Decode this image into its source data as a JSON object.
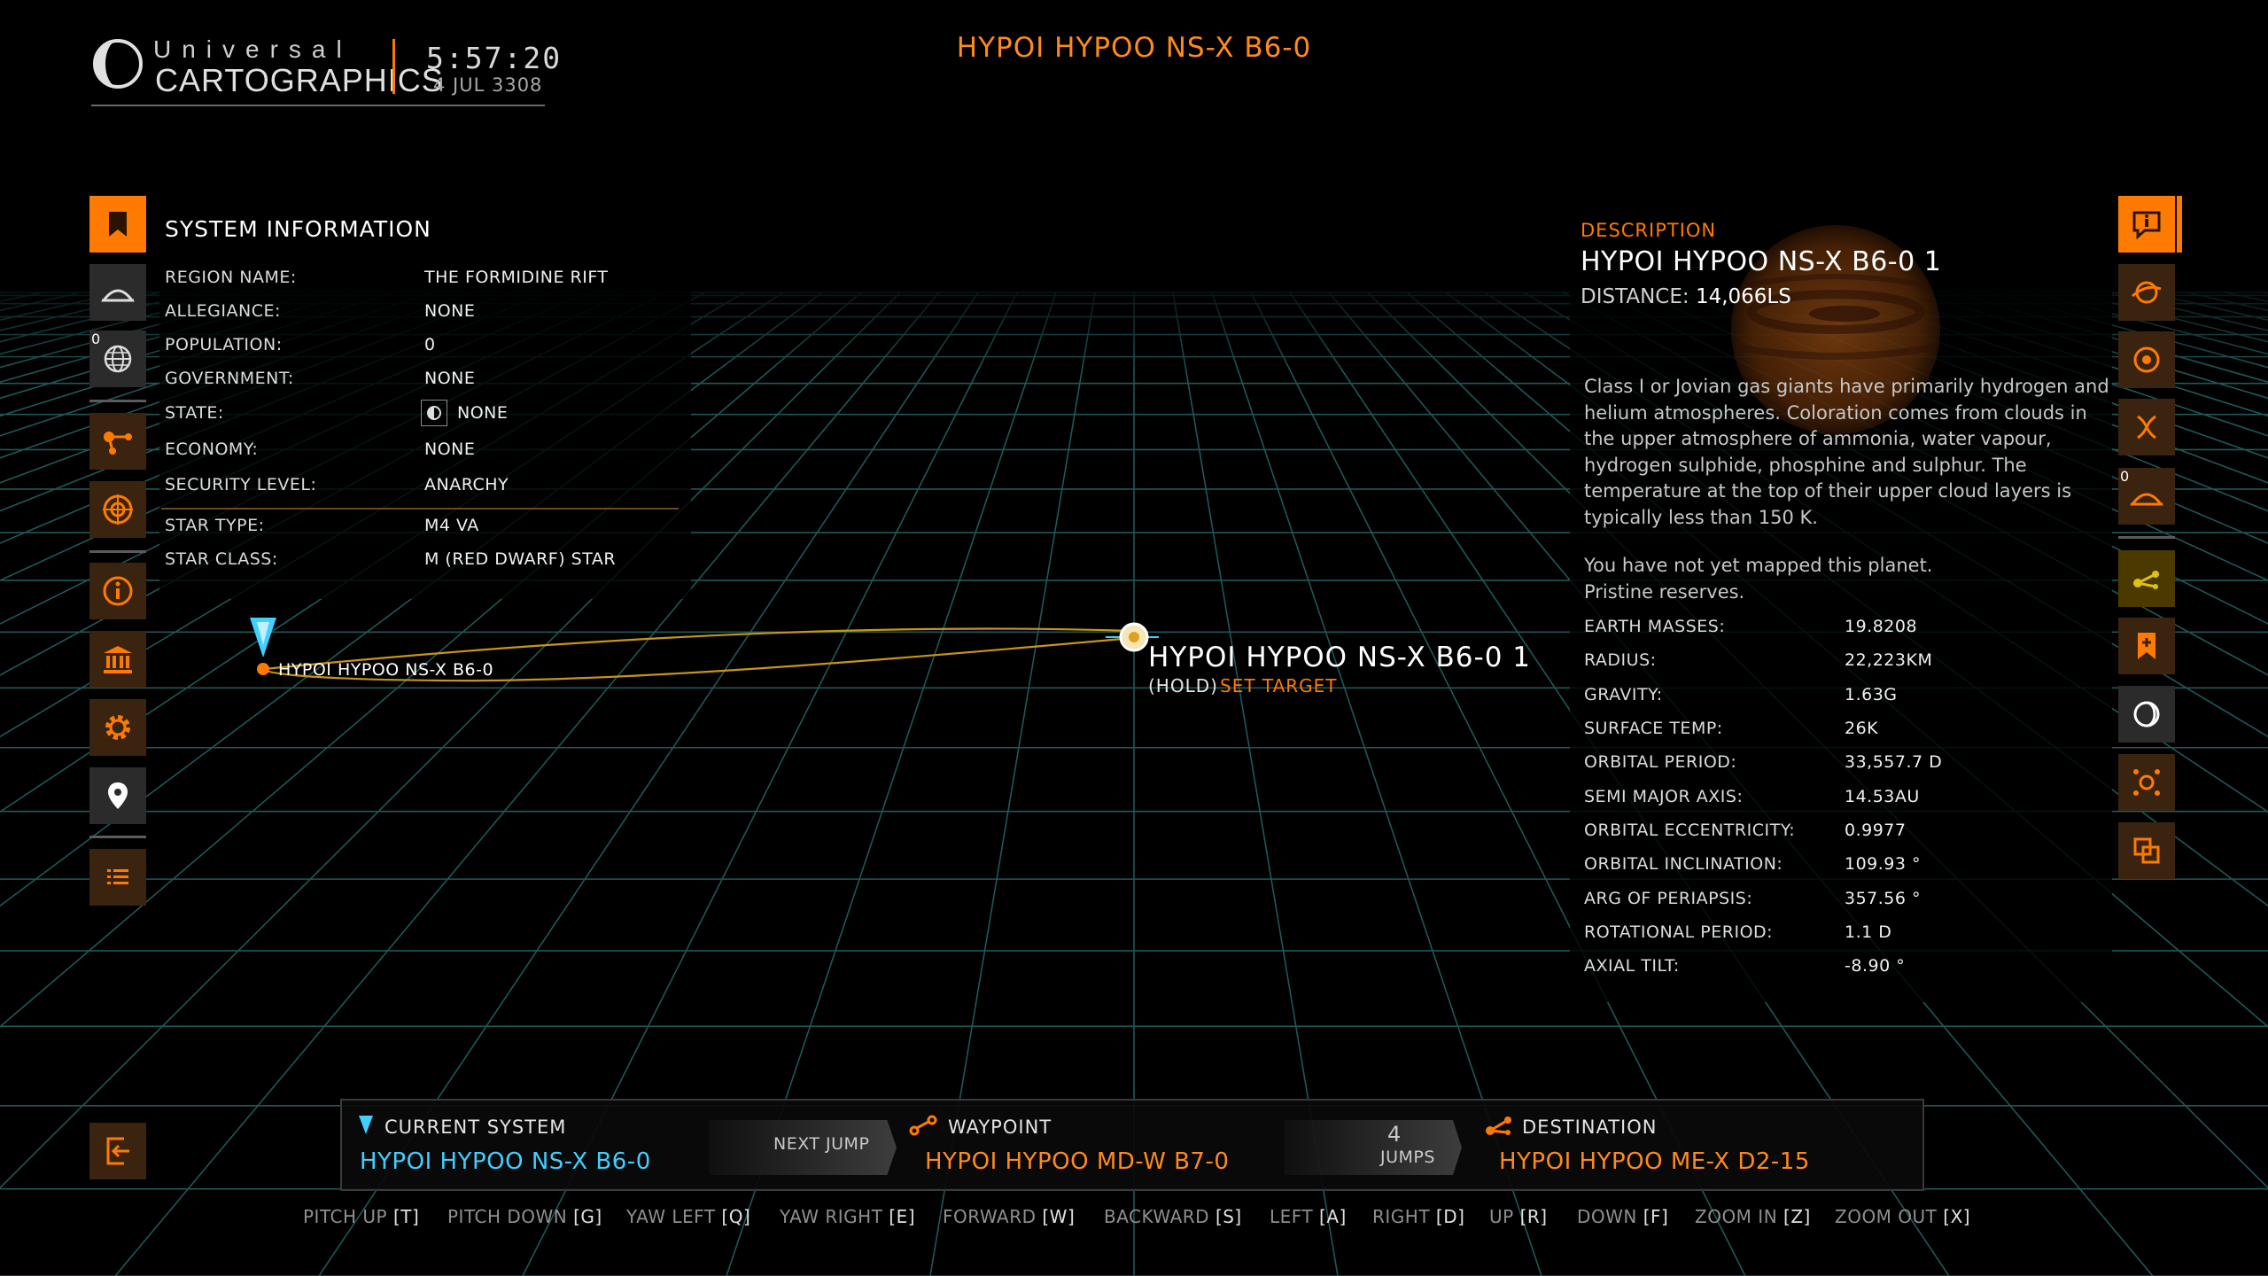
{
  "header": {
    "logo_word1": "Universal",
    "logo_word2": "CARTOGRAPHICS",
    "time": "5:57:20",
    "date": "4 JUL 3308",
    "title": "HYPOI HYPOO NS-X B6-0"
  },
  "left_nav": {
    "badge_count": "0",
    "items": [
      {
        "icon": "bookmark-icon",
        "active": true
      },
      {
        "icon": "planet-icon",
        "active": false
      },
      {
        "icon": "globe-icon",
        "active": false
      },
      {
        "icon": "route-icon",
        "active": false
      },
      {
        "icon": "target-globe-icon",
        "active": false
      },
      {
        "icon": "info-icon",
        "active": false
      },
      {
        "icon": "government-icon",
        "active": false
      },
      {
        "icon": "gear-icon",
        "active": false
      },
      {
        "icon": "map-pin-icon",
        "active": false
      },
      {
        "icon": "list-icon",
        "active": false
      },
      {
        "icon": "exit-icon",
        "active": false
      }
    ]
  },
  "system_info": {
    "title": "SYSTEM INFORMATION",
    "rows": [
      {
        "label": "REGION NAME:",
        "value": "THE FORMIDINE RIFT"
      },
      {
        "label": "ALLEGIANCE:",
        "value": "NONE"
      },
      {
        "label": "POPULATION:",
        "value": "0"
      },
      {
        "label": "GOVERNMENT:",
        "value": "NONE"
      },
      {
        "label": "STATE:",
        "value": "NONE"
      },
      {
        "label": "ECONOMY:",
        "value": "NONE"
      },
      {
        "label": "SECURITY LEVEL:",
        "value": "ANARCHY"
      },
      {
        "label": "STAR TYPE:",
        "value": "M4 VA"
      },
      {
        "label": "STAR CLASS:",
        "value": "M (RED DWARF) STAR"
      }
    ]
  },
  "description": {
    "heading": "DESCRIPTION",
    "body_name": "HYPOI HYPOO NS-X B6-0 1",
    "distance_label": "DISTANCE:",
    "distance_value": "14,066LS",
    "lines": [
      "Class I or Jovian gas giants have primarily hydrogen and",
      "helium atmospheres. Coloration comes from clouds in",
      "the upper atmosphere of ammonia, water vapour,",
      "hydrogen sulphide, phosphine and sulphur. The",
      "temperature at the top of their upper cloud layers is",
      "typically less than 150 K."
    ],
    "map_status": "You have not yet mapped this planet.",
    "reserves": "Pristine reserves.",
    "properties": [
      {
        "label": "EARTH MASSES:",
        "value": "19.8208"
      },
      {
        "label": "RADIUS:",
        "value": "22,223KM"
      },
      {
        "label": "GRAVITY:",
        "value": "1.63G"
      },
      {
        "label": "SURFACE TEMP:",
        "value": "26K"
      },
      {
        "label": "ORBITAL PERIOD:",
        "value": "33,557.7 D"
      },
      {
        "label": "SEMI MAJOR AXIS:",
        "value": "14.53AU"
      },
      {
        "label": "ORBITAL ECCENTRICITY:",
        "value": "0.9977"
      },
      {
        "label": "ORBITAL INCLINATION:",
        "value": "109.93 °"
      },
      {
        "label": "ARG OF PERIAPSIS:",
        "value": "357.56 °"
      },
      {
        "label": "ROTATIONAL PERIOD:",
        "value": "1.1 D"
      },
      {
        "label": "AXIAL TILT:",
        "value": "-8.90 °"
      }
    ]
  },
  "right_nav": {
    "badge_count": "0",
    "items": [
      {
        "icon": "info-icon",
        "active": true
      },
      {
        "icon": "planet-scan-icon"
      },
      {
        "icon": "target-icon"
      },
      {
        "icon": "dna-icon"
      },
      {
        "icon": "planet-icon"
      },
      {
        "icon": "route-icon"
      },
      {
        "icon": "bookmark-add-icon"
      },
      {
        "icon": "moon-icon"
      },
      {
        "icon": "focus-icon"
      },
      {
        "icon": "swap-icon"
      }
    ]
  },
  "map": {
    "current_system_label": "HYPOI HYPOO NS-X B6-0",
    "planet_label": "HYPOI HYPOO NS-X B6-0 1",
    "hold_label": "(HOLD)",
    "set_target_label": "SET TARGET"
  },
  "route": {
    "current_heading": "CURRENT SYSTEM",
    "current_system": "HYPOI HYPOO NS-X B6-0",
    "next_jump_label": "NEXT JUMP",
    "waypoint_heading": "WAYPOINT",
    "waypoint_system": "HYPOI HYPOO MD-W B7-0",
    "jumps_count": "4",
    "jumps_label": "JUMPS",
    "destination_heading": "DESTINATION",
    "destination_system": "HYPOI HYPOO ME-X D2-15"
  },
  "controls": [
    {
      "action": "PITCH UP",
      "key": "[T]"
    },
    {
      "action": "PITCH DOWN",
      "key": "[G]"
    },
    {
      "action": "YAW LEFT",
      "key": "[Q]"
    },
    {
      "action": "YAW RIGHT",
      "key": "[E]"
    },
    {
      "action": "FORWARD",
      "key": "[W]"
    },
    {
      "action": "BACKWARD",
      "key": "[S]"
    },
    {
      "action": "LEFT",
      "key": "[A]"
    },
    {
      "action": "RIGHT",
      "key": "[D]"
    },
    {
      "action": "UP",
      "key": "[R]"
    },
    {
      "action": "DOWN",
      "key": "[F]"
    },
    {
      "action": "ZOOM IN",
      "key": "[Z]"
    },
    {
      "action": "ZOOM OUT",
      "key": "[X]"
    }
  ],
  "colors": {
    "accent": "#ff7a00",
    "cyan": "#3fd0ff",
    "grid": "#1f5858",
    "panel_dark": "#3a2410"
  }
}
